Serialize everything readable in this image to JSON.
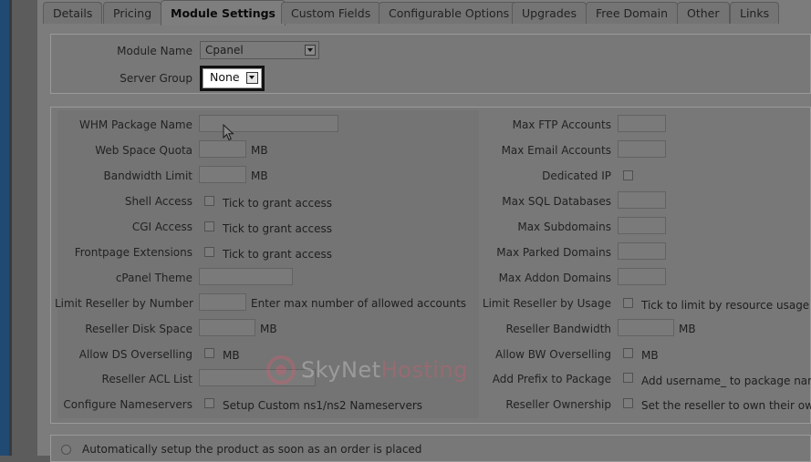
{
  "tabs": [
    "Details",
    "Pricing",
    "Module Settings",
    "Custom Fields",
    "Configurable Options",
    "Upgrades",
    "Free Domain",
    "Other",
    "Links"
  ],
  "active_tab": "Module Settings",
  "module": {
    "module_name_label": "Module Name",
    "module_name_value": "Cpanel",
    "server_group_label": "Server Group",
    "server_group_value": "None"
  },
  "left_fields": {
    "whm_package_name": "WHM Package Name",
    "web_space_quota": "Web Space Quota",
    "web_space_unit": "MB",
    "bandwidth_limit": "Bandwidth Limit",
    "bandwidth_unit": "MB",
    "shell_access": "Shell Access",
    "shell_access_note": "Tick to grant access",
    "cgi_access": "CGI Access",
    "cgi_access_note": "Tick to grant access",
    "frontpage_extensions": "Frontpage Extensions",
    "frontpage_note": "Tick to grant access",
    "cpanel_theme": "cPanel Theme",
    "limit_reseller_number": "Limit Reseller by Number",
    "limit_reseller_number_note": "Enter max number of allowed accounts",
    "reseller_disk_space": "Reseller Disk Space",
    "reseller_disk_unit": "MB",
    "allow_ds_overselling": "Allow DS Overselling",
    "allow_ds_unit": "MB",
    "reseller_acl_list": "Reseller ACL List",
    "configure_nameservers": "Configure Nameservers",
    "configure_nameservers_note": "Setup Custom ns1/ns2 Nameservers"
  },
  "right_fields": {
    "max_ftp_accounts": "Max FTP Accounts",
    "max_email_accounts": "Max Email Accounts",
    "dedicated_ip": "Dedicated IP",
    "max_sql_databases": "Max SQL Databases",
    "max_subdomains": "Max Subdomains",
    "max_parked_domains": "Max Parked Domains",
    "max_addon_domains": "Max Addon Domains",
    "limit_reseller_usage": "Limit Reseller by Usage",
    "limit_reseller_usage_note": "Tick to limit by resource usage",
    "reseller_bandwidth": "Reseller Bandwidth",
    "reseller_bandwidth_unit": "MB",
    "allow_bw_overselling": "Allow BW Overselling",
    "allow_bw_unit": "MB",
    "add_prefix_to_package": "Add Prefix to Package",
    "add_prefix_note": "Add username_ to package name",
    "reseller_ownership": "Reseller Ownership",
    "reseller_ownership_note": "Set the reseller to own their own"
  },
  "auto_setup": {
    "option1": "Automatically setup the product as soon as an order is placed"
  },
  "watermark": {
    "text": "SkyNetHosting"
  },
  "colors": {
    "sidebar_accent": "#214a72",
    "watermark": "#e05a6e"
  }
}
